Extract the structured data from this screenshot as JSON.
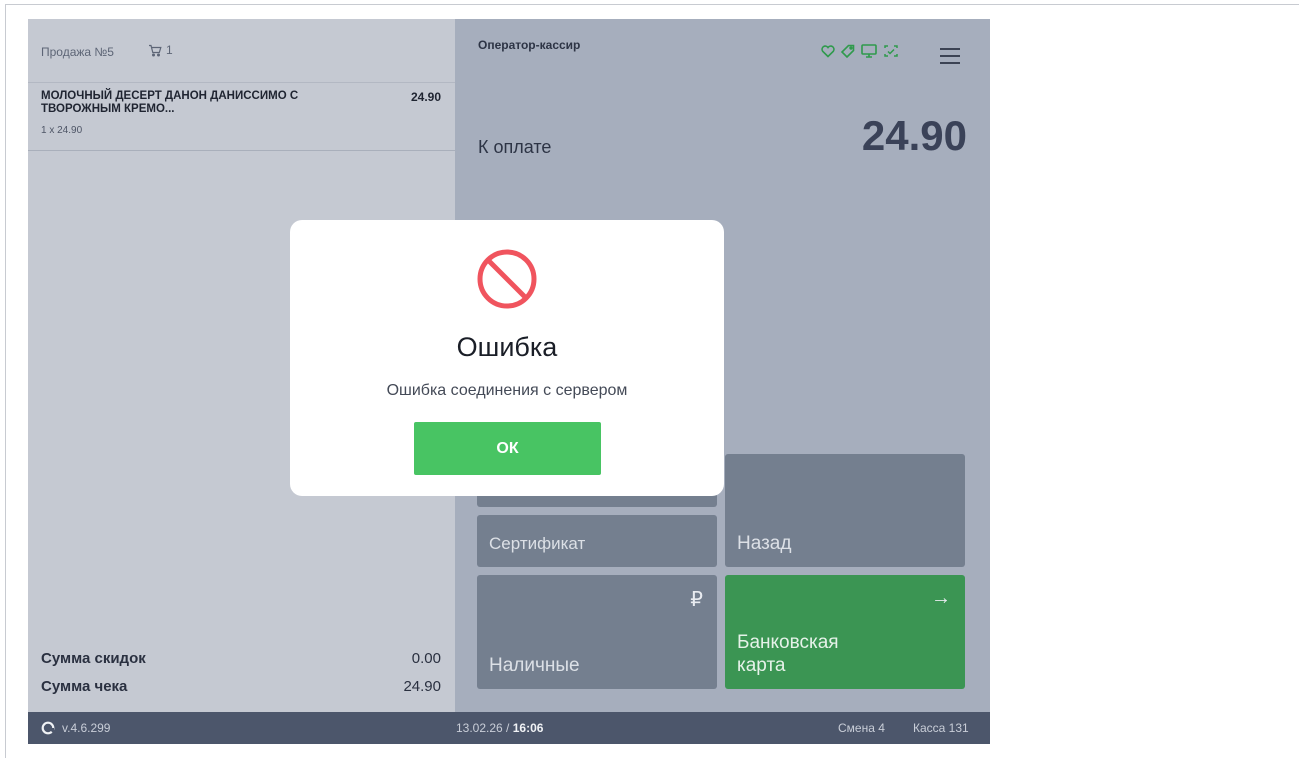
{
  "sale": {
    "title": "Продажа №5",
    "cart_count": "1"
  },
  "items": [
    {
      "name": "МОЛОЧНЫЙ ДЕСЕРТ ДАНОН ДАНИССИМО С ТВОРОЖНЫМ КРЕМО...",
      "price": "24.90",
      "qty_line": "1 x 24.90"
    }
  ],
  "totals": {
    "discount_label": "Сумма скидок",
    "discount_value": "0.00",
    "receipt_label": "Сумма чека",
    "receipt_value": "24.90"
  },
  "header": {
    "operator": "Оператор-кассир",
    "icon_color": "#2f9a4c",
    "icons": [
      "heart-icon",
      "tag-icon",
      "monitor-icon",
      "checklist-icon",
      "menu-icon"
    ]
  },
  "payment": {
    "label": "К оплате",
    "amount": "24.90"
  },
  "tiles": {
    "certificate": "Сертификат",
    "back": "Назад",
    "cash": "Наличные",
    "cash_symbol": "₽",
    "card": "Банковская карта",
    "card_arrow": "→"
  },
  "status": {
    "version": "v.4.6.299",
    "date": "13.02.26",
    "separator": " / ",
    "time": "16:06",
    "shift": "Смена 4",
    "register": "Касса 131"
  },
  "modal": {
    "title": "Ошибка",
    "message": "Ошибка соединения с сервером",
    "ok_label": "ОК",
    "accent_color": "#f0545e",
    "button_color": "#48c463"
  }
}
